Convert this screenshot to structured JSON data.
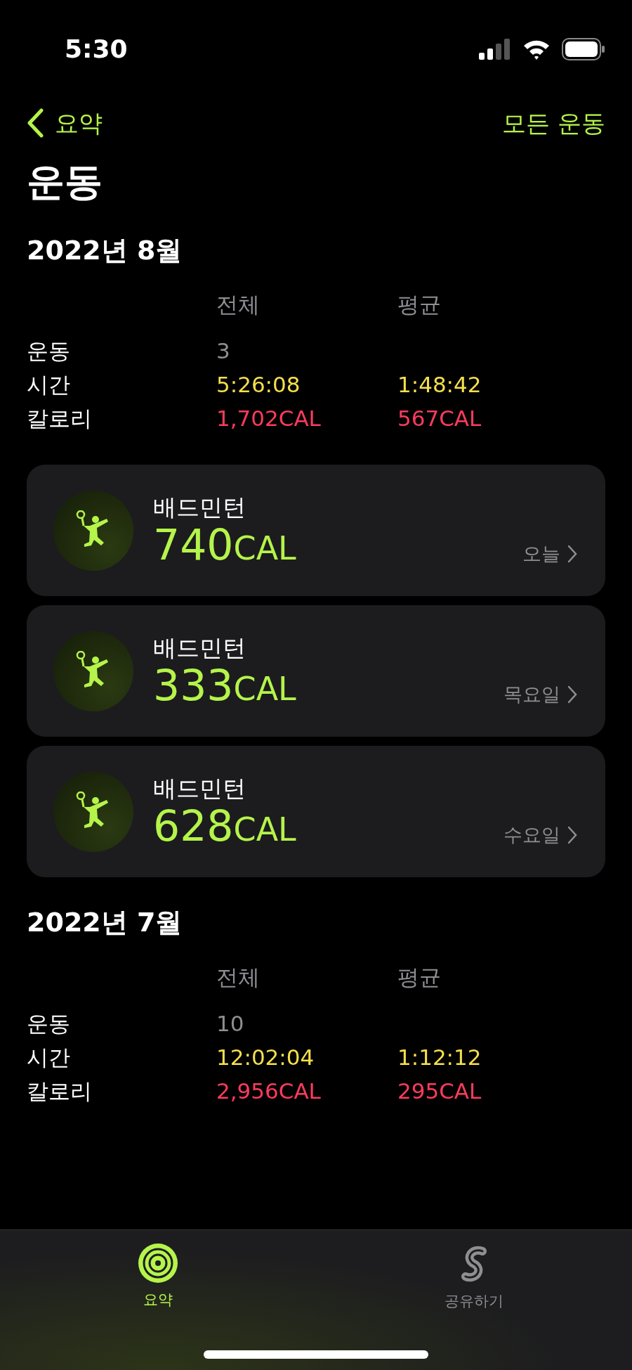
{
  "status_bar": {
    "time": "5:30"
  },
  "nav": {
    "back_label": "요약",
    "action_label": "모든 운동"
  },
  "title": "운동",
  "months": [
    {
      "title": "2022년 8월",
      "columns": [
        "전체",
        "평균"
      ],
      "rows": [
        {
          "kind": "count",
          "label": "운동",
          "total": "3"
        },
        {
          "kind": "time",
          "label": "시간",
          "total": "5:26:08",
          "average": "1:48:42"
        },
        {
          "kind": "calories",
          "label": "칼로리",
          "total": "1,702CAL",
          "average": "567CAL"
        }
      ],
      "workouts": [
        {
          "name": "배드민턴",
          "value": "740",
          "unit": "CAL",
          "day": "오늘"
        },
        {
          "name": "배드민턴",
          "value": "333",
          "unit": "CAL",
          "day": "목요일"
        },
        {
          "name": "배드민턴",
          "value": "628",
          "unit": "CAL",
          "day": "수요일"
        }
      ]
    },
    {
      "title": "2022년 7월",
      "columns": [
        "전체",
        "평균"
      ],
      "rows": [
        {
          "kind": "count",
          "label": "운동",
          "total": "10"
        },
        {
          "kind": "time",
          "label": "시간",
          "total": "12:02:04",
          "average": "1:12:12"
        },
        {
          "kind": "calories",
          "label": "칼로리",
          "total": "2,956CAL",
          "average": "295CAL"
        }
      ]
    }
  ],
  "tabs": [
    {
      "kind": "summary",
      "label": "요약",
      "selected": true
    },
    {
      "kind": "sharing",
      "label": "공유하기",
      "selected": false
    }
  ]
}
